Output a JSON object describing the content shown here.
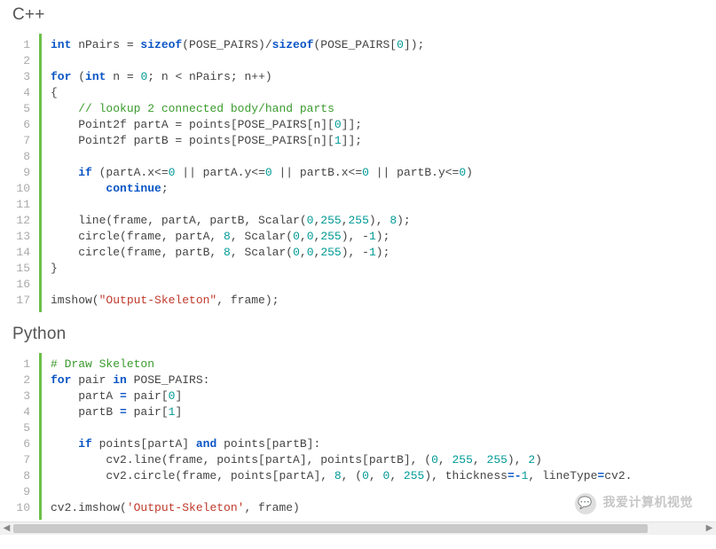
{
  "headings": {
    "cpp": "C++",
    "python": "Python"
  },
  "cpp": {
    "lines": [
      [
        {
          "cls": "kw",
          "t": "int"
        },
        {
          "t": " nPairs = "
        },
        {
          "cls": "kw",
          "t": "sizeof"
        },
        {
          "t": "(POSE_PAIRS)/"
        },
        {
          "cls": "kw",
          "t": "sizeof"
        },
        {
          "t": "(POSE_PAIRS["
        },
        {
          "cls": "num",
          "t": "0"
        },
        {
          "t": "]);"
        }
      ],
      [],
      [
        {
          "cls": "kw",
          "t": "for"
        },
        {
          "t": " ("
        },
        {
          "cls": "kw",
          "t": "int"
        },
        {
          "t": " n = "
        },
        {
          "cls": "num",
          "t": "0"
        },
        {
          "t": "; n < nPairs; n++)"
        }
      ],
      [
        {
          "t": "{"
        }
      ],
      [
        {
          "t": "    "
        },
        {
          "cls": "cmt",
          "t": "// lookup 2 connected body/hand parts"
        }
      ],
      [
        {
          "t": "    Point2f partA = points[POSE_PAIRS[n]["
        },
        {
          "cls": "num",
          "t": "0"
        },
        {
          "t": "]];"
        }
      ],
      [
        {
          "t": "    Point2f partB = points[POSE_PAIRS[n]["
        },
        {
          "cls": "num",
          "t": "1"
        },
        {
          "t": "]];"
        }
      ],
      [],
      [
        {
          "t": "    "
        },
        {
          "cls": "kw",
          "t": "if"
        },
        {
          "t": " (partA.x<="
        },
        {
          "cls": "num",
          "t": "0"
        },
        {
          "t": " || partA.y<="
        },
        {
          "cls": "num",
          "t": "0"
        },
        {
          "t": " || partB.x<="
        },
        {
          "cls": "num",
          "t": "0"
        },
        {
          "t": " || partB.y<="
        },
        {
          "cls": "num",
          "t": "0"
        },
        {
          "t": ")"
        }
      ],
      [
        {
          "t": "        "
        },
        {
          "cls": "kw",
          "t": "continue"
        },
        {
          "t": ";"
        }
      ],
      [],
      [
        {
          "t": "    line(frame, partA, partB, Scalar("
        },
        {
          "cls": "num",
          "t": "0"
        },
        {
          "t": ","
        },
        {
          "cls": "num",
          "t": "255"
        },
        {
          "t": ","
        },
        {
          "cls": "num",
          "t": "255"
        },
        {
          "t": "), "
        },
        {
          "cls": "num",
          "t": "8"
        },
        {
          "t": ");"
        }
      ],
      [
        {
          "t": "    circle(frame, partA, "
        },
        {
          "cls": "num",
          "t": "8"
        },
        {
          "t": ", Scalar("
        },
        {
          "cls": "num",
          "t": "0"
        },
        {
          "t": ","
        },
        {
          "cls": "num",
          "t": "0"
        },
        {
          "t": ","
        },
        {
          "cls": "num",
          "t": "255"
        },
        {
          "t": "), -"
        },
        {
          "cls": "num",
          "t": "1"
        },
        {
          "t": ");"
        }
      ],
      [
        {
          "t": "    circle(frame, partB, "
        },
        {
          "cls": "num",
          "t": "8"
        },
        {
          "t": ", Scalar("
        },
        {
          "cls": "num",
          "t": "0"
        },
        {
          "t": ","
        },
        {
          "cls": "num",
          "t": "0"
        },
        {
          "t": ","
        },
        {
          "cls": "num",
          "t": "255"
        },
        {
          "t": "), -"
        },
        {
          "cls": "num",
          "t": "1"
        },
        {
          "t": ");"
        }
      ],
      [
        {
          "t": "}"
        }
      ],
      [],
      [
        {
          "t": "imshow("
        },
        {
          "cls": "str",
          "t": "\"Output-Skeleton\""
        },
        {
          "t": ", frame);"
        }
      ]
    ]
  },
  "python": {
    "lines": [
      [
        {
          "cls": "cmt",
          "t": "# Draw Skeleton"
        }
      ],
      [
        {
          "cls": "kw",
          "t": "for"
        },
        {
          "t": " pair "
        },
        {
          "cls": "kw",
          "t": "in"
        },
        {
          "t": " POSE_PAIRS:"
        }
      ],
      [
        {
          "t": "    partA "
        },
        {
          "cls": "kw",
          "t": "="
        },
        {
          "t": " pair["
        },
        {
          "cls": "num",
          "t": "0"
        },
        {
          "t": "]"
        }
      ],
      [
        {
          "t": "    partB "
        },
        {
          "cls": "kw",
          "t": "="
        },
        {
          "t": " pair["
        },
        {
          "cls": "num",
          "t": "1"
        },
        {
          "t": "]"
        }
      ],
      [],
      [
        {
          "t": "    "
        },
        {
          "cls": "kw",
          "t": "if"
        },
        {
          "t": " points[partA] "
        },
        {
          "cls": "kw",
          "t": "and"
        },
        {
          "t": " points[partB]:"
        }
      ],
      [
        {
          "t": "        cv2.line(frame, points[partA], points[partB], ("
        },
        {
          "cls": "num",
          "t": "0"
        },
        {
          "t": ", "
        },
        {
          "cls": "num",
          "t": "255"
        },
        {
          "t": ", "
        },
        {
          "cls": "num",
          "t": "255"
        },
        {
          "t": "), "
        },
        {
          "cls": "num",
          "t": "2"
        },
        {
          "t": ")"
        }
      ],
      [
        {
          "t": "        cv2.circle(frame, points[partA], "
        },
        {
          "cls": "num",
          "t": "8"
        },
        {
          "t": ", ("
        },
        {
          "cls": "num",
          "t": "0"
        },
        {
          "t": ", "
        },
        {
          "cls": "num",
          "t": "0"
        },
        {
          "t": ", "
        },
        {
          "cls": "num",
          "t": "255"
        },
        {
          "t": "), thickness"
        },
        {
          "cls": "kw",
          "t": "="
        },
        {
          "cls": "kw",
          "t": "-"
        },
        {
          "cls": "num",
          "t": "1"
        },
        {
          "t": ", lineType"
        },
        {
          "cls": "kw",
          "t": "="
        },
        {
          "t": "cv2."
        }
      ],
      [],
      [
        {
          "t": "cv2.imshow("
        },
        {
          "cls": "str",
          "t": "'Output-Skeleton'"
        },
        {
          "t": ", frame)"
        }
      ]
    ]
  },
  "watermark": {
    "text": "我爱计算机视觉",
    "emoji": "💬"
  },
  "scroll": {
    "left_arrow": "◀",
    "right_arrow": "▶"
  }
}
